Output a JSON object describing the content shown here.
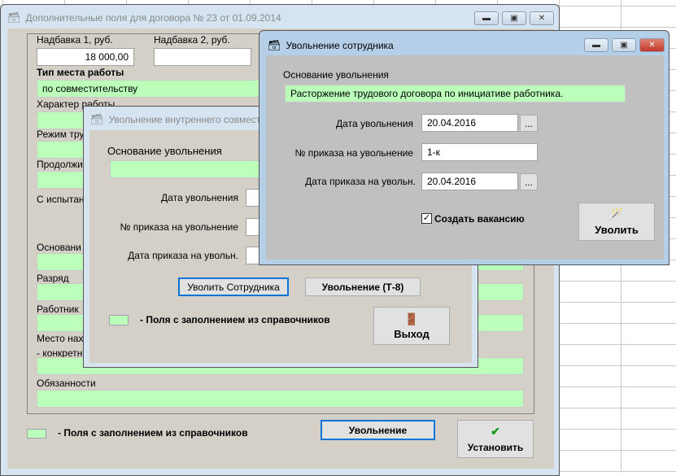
{
  "main_window": {
    "title": "Дополнительные поля для договора № 23 от 01.09.2014",
    "nadbavka1_label": "Надбавка 1, руб.",
    "nadbavka1_value": "18 000,00",
    "nadbavka2_label": "Надбавка 2, руб.",
    "nadbavka2_value": "",
    "tip_label": "Тип места работы",
    "tip_value": "по совместительству",
    "harakter_label": "Характер работы",
    "rezhim_label": "Режим тру",
    "prodolzh_label": "Продолжи",
    "ispytan_label": "С испытан",
    "osnovanie_label": "Основани",
    "razryad_label": "Разряд",
    "rabotnik_label": "Работник",
    "mesto_label": "Место нах",
    "konkret_label": "- конкретн",
    "obyaz_label": "Обязанности",
    "legend_text": "-  Поля с заполнением из справочников",
    "uvolnenie_button": "Увольнение",
    "ustanovit_button": "Установить"
  },
  "middle_window": {
    "title": "Увольнение внутреннего совмест",
    "osnovanie_label": "Основание увольнения",
    "data_label": "Дата увольнения",
    "prikaz_label": "№ приказа на увольнение",
    "data_prikaza_label": "Дата приказа на увольн.",
    "uvolit_sotr_button": "Уволить Сотрудника",
    "t8_button": "Увольнение (Т-8)",
    "legend_text": "-  Поля с заполнением из справочников",
    "exit_button": "Выход"
  },
  "front_window": {
    "title": "Увольнение сотрудника",
    "osnovanie_label": "Основание увольнения",
    "osnovanie_value": "Расторжение трудового договора по инициативе работника.",
    "data_label": "Дата увольнения",
    "data_value": "20.04.2016",
    "prikaz_label": "№ приказа на увольнение",
    "prikaz_value": "1-к",
    "data_prikaza_label": "Дата приказа на увольн.",
    "data_prikaza_value": "20.04.2016",
    "ellipsis": "...",
    "vakansiya_label": "Создать вакансию",
    "vakansiya_checked": true,
    "uvolit_button": "Уволить"
  },
  "colors": {
    "green_field": "#bbffbb",
    "focus": "#0a74d8",
    "client": "#d4d0c8",
    "front_client": "#c0c0c0"
  }
}
